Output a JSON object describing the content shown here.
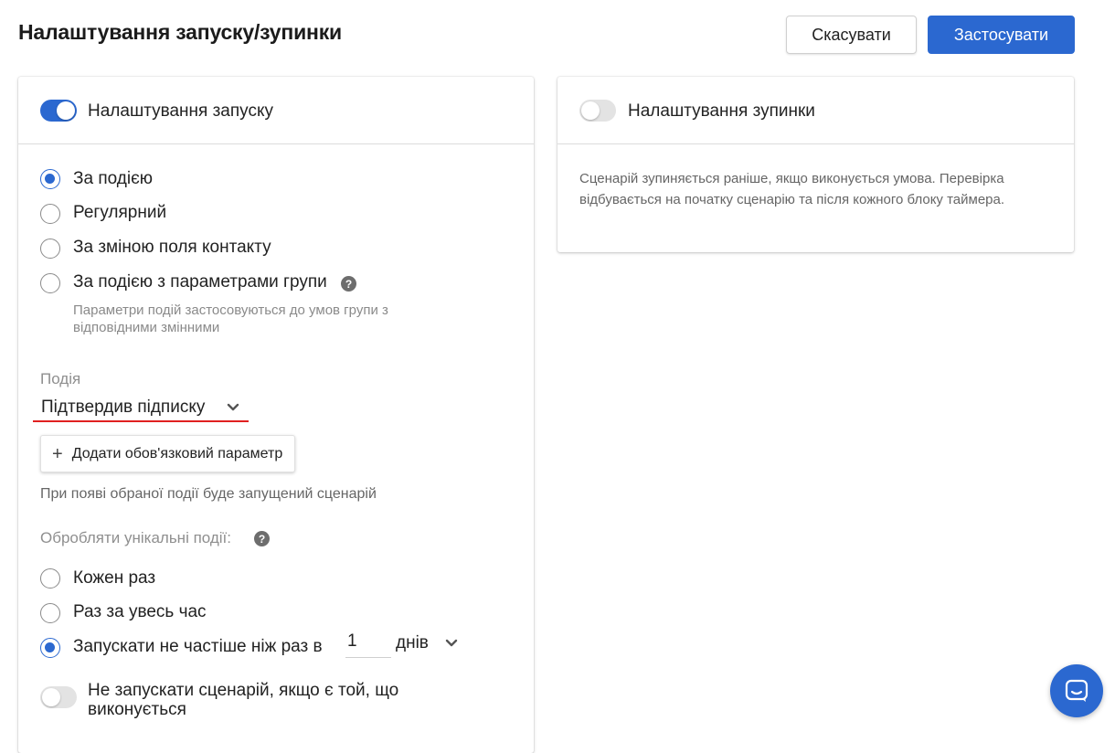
{
  "header": {
    "title": "Налаштування запуску/зупинки",
    "cancel_label": "Скасувати",
    "apply_label": "Застосувати"
  },
  "start_settings": {
    "title": "Налаштування запуску",
    "enabled": true,
    "trigger_options": [
      {
        "label": "За подією",
        "checked": true
      },
      {
        "label": "Регулярний",
        "checked": false
      },
      {
        "label": "За зміною поля контакту",
        "checked": false
      },
      {
        "label": "За подією з параметрами групи",
        "checked": false
      }
    ],
    "group_params_hint": "Параметри подій застосовуються до умов групи з відповідними змінними",
    "event_label": "Подія",
    "event_value": "Підтвердив підписку",
    "add_param_label": "Додати обов'язковий параметр",
    "event_hint": "При появі обраної події буде запущений сценарій",
    "unique_label": "Обробляти унікальні події:",
    "unique_options": [
      {
        "label": "Кожен раз",
        "checked": false
      },
      {
        "label": "Раз за увесь час",
        "checked": false
      },
      {
        "label": "Запускати не частіше ніж раз в",
        "checked": true
      }
    ],
    "frequency_value": "1",
    "frequency_unit": "днів",
    "skip_running_label": "Не запускати сценарій, якщо є той, що виконується",
    "skip_running_enabled": false
  },
  "stop_settings": {
    "title": "Налаштування зупинки",
    "enabled": false,
    "description": "Сценарій зупиняється раніше, якщо виконується умова. Перевірка відбувається на початку сценарію та після кожного блоку таймера."
  },
  "colors": {
    "accent": "#2b68d0",
    "highlight_underline": "#e02020"
  },
  "icons": {
    "help": "question-circle-icon",
    "chevron": "chevron-down-icon",
    "plus": "plus-icon",
    "chat": "chat-bubble-icon"
  }
}
